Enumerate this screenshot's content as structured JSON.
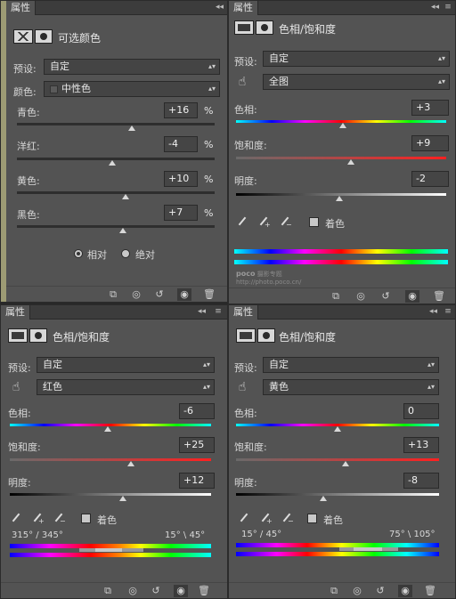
{
  "panel1": {
    "tab_label": "属性",
    "title": "可选颜色",
    "preset_label": "预设:",
    "preset_value": "自定",
    "colors_label": "颜色:",
    "colors_value": "中性色",
    "sliders": [
      {
        "label": "青色:",
        "value": "+16",
        "unit": "%",
        "level": 0.58
      },
      {
        "label": "洋红:",
        "value": "-4",
        "unit": "%",
        "level": 0.48
      },
      {
        "label": "黄色:",
        "value": "+10",
        "unit": "%",
        "level": 0.55
      },
      {
        "label": "黑色:",
        "value": "+7",
        "unit": "%",
        "level": 0.535
      }
    ],
    "radio_relative": "相对",
    "radio_absolute": "绝对",
    "relative_selected": true
  },
  "panel2": {
    "tab_label": "属性",
    "title": "色相/饱和度",
    "preset_label": "预设:",
    "preset_value": "自定",
    "channel_value": "全图",
    "hue_label": "色相:",
    "hue_value": "+3",
    "sat_label": "饱和度:",
    "sat_value": "+9",
    "light_label": "明度:",
    "light_value": "-2",
    "colorize_label": "着色",
    "watermark_brand": "poco",
    "watermark_text": "摄影专题",
    "watermark_url": "http://photo.poco.cn/",
    "hue_level": 0.51,
    "sat_level": 0.545,
    "light_level": 0.49
  },
  "panel3": {
    "tab_label": "属性",
    "title": "色相/饱和度",
    "preset_label": "预设:",
    "preset_value": "自定",
    "channel_value": "红色",
    "hue_label": "色相:",
    "hue_value": "-6",
    "sat_label": "饱和度:",
    "sat_value": "+25",
    "light_label": "明度:",
    "light_value": "+12",
    "colorize_label": "着色",
    "range_left": "315° / 345°",
    "range_right": "15° \\ 45°",
    "hue_level": 0.485,
    "sat_level": 0.6,
    "light_level": 0.56
  },
  "panel4": {
    "tab_label": "属性",
    "title": "色相/饱和度",
    "preset_label": "预设:",
    "preset_value": "自定",
    "channel_value": "黄色",
    "hue_label": "色相:",
    "hue_value": "0",
    "sat_label": "饱和度:",
    "sat_value": "+13",
    "light_label": "明度:",
    "light_value": "-8",
    "colorize_label": "着色",
    "range_left": "15° / 45°",
    "range_right": "75° \\ 105°",
    "hue_level": 0.5,
    "sat_level": 0.54,
    "light_level": 0.43
  },
  "colors": {
    "panel_bg": "#535353",
    "titlebar_bg": "#3c3c3c",
    "field_bg": "#444444",
    "text": "#d6d6d6"
  }
}
